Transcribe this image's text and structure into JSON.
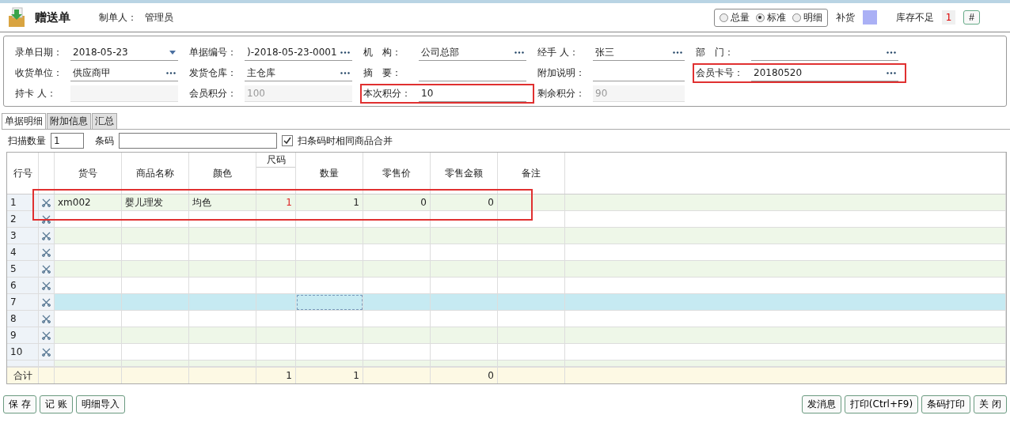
{
  "header": {
    "title": "赠送单",
    "maker_label": "制单人：",
    "maker": "管理员",
    "view_modes": [
      {
        "label": "总量",
        "selected": false
      },
      {
        "label": "标准",
        "selected": true
      },
      {
        "label": "明细",
        "selected": false
      }
    ],
    "replenish_label": "补货",
    "shortage_label": "库存不足",
    "shortage_count": "1",
    "hash_button": "#"
  },
  "form": {
    "rows": [
      [
        {
          "label": "录单日期：",
          "value": "2018-05-23",
          "kind": "dropdown",
          "highlighted": false
        },
        {
          "label": "单据编号：",
          "value": ")-2018-05-23-0001",
          "kind": "lookup",
          "highlighted": false
        },
        {
          "label": "机　构：",
          "value": "公司总部",
          "kind": "lookup",
          "highlighted": false
        },
        {
          "label": "经手 人：",
          "value": "张三",
          "kind": "lookup",
          "highlighted": false
        },
        {
          "label": "部　门：",
          "kind": "lookup",
          "highlighted": false
        }
      ],
      [
        {
          "label": "收货单位：",
          "value": "供应商甲",
          "kind": "lookup",
          "highlighted": false
        },
        {
          "label": "发货仓库：",
          "value": "主仓库",
          "kind": "lookup",
          "highlighted": false
        },
        {
          "label": "摘　要：",
          "kind": "text",
          "highlighted": false
        },
        {
          "label": "附加说明：",
          "kind": "text",
          "highlighted": false
        },
        {
          "label": "会员卡号：",
          "value": "20180520",
          "kind": "lookup",
          "highlighted": true
        }
      ],
      [
        {
          "label": "持卡 人：",
          "kind": "readonly",
          "highlighted": false
        },
        {
          "label": "会员积分：",
          "value": "100",
          "kind": "readonly",
          "highlighted": false
        },
        {
          "label": "本次积分：",
          "value": "10",
          "kind": "text",
          "highlighted": true
        },
        {
          "label": "剩余积分：",
          "value": "90",
          "kind": "readonly",
          "highlighted": false
        }
      ]
    ]
  },
  "tabs": [
    {
      "label": "单据明细",
      "selected": true
    },
    {
      "label": "附加信息",
      "selected": false
    },
    {
      "label": "汇总",
      "selected": false
    }
  ],
  "scan": {
    "quantity_label": "扫描数量",
    "quantity": "1",
    "barcode_label": "条码",
    "merge_label": "扫条码时相同商品合并",
    "merge_checked": true
  },
  "table": {
    "columns": [
      "行号",
      "",
      "货号",
      "商品名称",
      "颜色",
      "尺码",
      "数量",
      "零售价",
      "零售金额",
      "备注"
    ],
    "rows": [
      {
        "cells": [
          "1",
          "",
          "xm002",
          "婴儿理发",
          "均色",
          "1",
          "1",
          "0",
          "0",
          ""
        ],
        "selected": false,
        "highlighted": true
      },
      {
        "cells": [
          "2",
          "",
          "",
          "",
          "",
          "",
          "",
          "",
          "",
          ""
        ],
        "selected": false,
        "highlighted": false
      },
      {
        "cells": [
          "3",
          "",
          "",
          "",
          "",
          "",
          "",
          "",
          "",
          ""
        ],
        "selected": false,
        "highlighted": false
      },
      {
        "cells": [
          "4",
          "",
          "",
          "",
          "",
          "",
          "",
          "",
          "",
          ""
        ],
        "selected": false,
        "highlighted": false
      },
      {
        "cells": [
          "5",
          "",
          "",
          "",
          "",
          "",
          "",
          "",
          "",
          ""
        ],
        "selected": false,
        "highlighted": false
      },
      {
        "cells": [
          "6",
          "",
          "",
          "",
          "",
          "",
          "",
          "",
          "",
          ""
        ],
        "selected": false,
        "highlighted": false
      },
      {
        "cells": [
          "7",
          "",
          "",
          "",
          "",
          "",
          "",
          "",
          "",
          ""
        ],
        "selected": true,
        "highlighted": false
      },
      {
        "cells": [
          "8",
          "",
          "",
          "",
          "",
          "",
          "",
          "",
          "",
          ""
        ],
        "selected": false,
        "highlighted": false
      },
      {
        "cells": [
          "9",
          "",
          "",
          "",
          "",
          "",
          "",
          "",
          "",
          ""
        ],
        "selected": false,
        "highlighted": false
      },
      {
        "cells": [
          "10",
          "",
          "",
          "",
          "",
          "",
          "",
          "",
          "",
          ""
        ],
        "selected": false,
        "highlighted": false
      }
    ],
    "total": {
      "cells": [
        "合计",
        "",
        "",
        "",
        "",
        "1",
        "1",
        "",
        "0",
        ""
      ]
    }
  },
  "buttons_left": [
    "保 存",
    "记 账",
    "明细导入"
  ],
  "buttons_right": [
    "发消息",
    "打印(Ctrl+F9)",
    "条码打印",
    "关 闭"
  ]
}
